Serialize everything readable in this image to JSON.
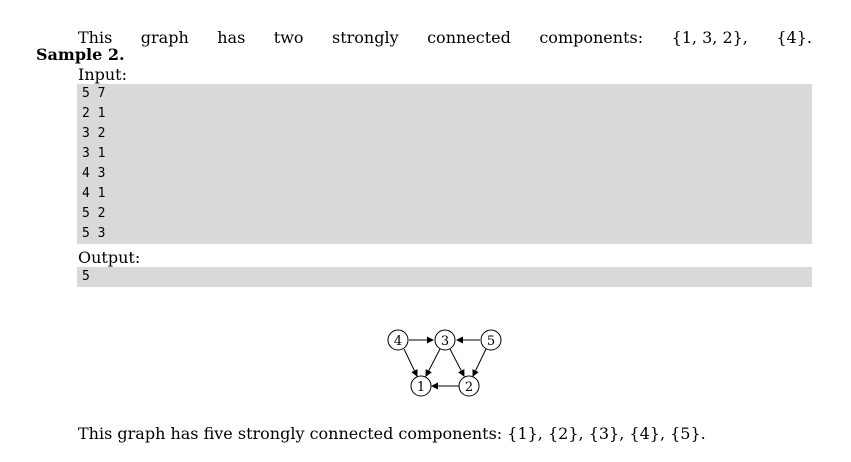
{
  "intro_line": {
    "words": [
      "This",
      "graph",
      "has",
      "two",
      "strongly",
      "connected",
      "components:",
      "{1, 3, 2},",
      "{4}."
    ]
  },
  "sample": {
    "title": "Sample 2.",
    "input_label": "Input:",
    "input_lines": [
      "5 7",
      "2 1",
      "3 2",
      "3 1",
      "4 3",
      "4 1",
      "5 2",
      "5 3"
    ],
    "output_label": "Output:",
    "output_lines": [
      "5"
    ]
  },
  "figure": {
    "nodes": [
      {
        "id": "4",
        "label": "4"
      },
      {
        "id": "3",
        "label": "3"
      },
      {
        "id": "5",
        "label": "5"
      },
      {
        "id": "1",
        "label": "1"
      },
      {
        "id": "2",
        "label": "2"
      }
    ],
    "edges": [
      {
        "from": "4",
        "to": "3"
      },
      {
        "from": "5",
        "to": "3"
      },
      {
        "from": "4",
        "to": "1"
      },
      {
        "from": "3",
        "to": "1"
      },
      {
        "from": "3",
        "to": "2"
      },
      {
        "from": "5",
        "to": "2"
      },
      {
        "from": "2",
        "to": "1"
      }
    ]
  },
  "caption": "This graph has five strongly connected components: {1}, {2}, {3}, {4}, {5}."
}
